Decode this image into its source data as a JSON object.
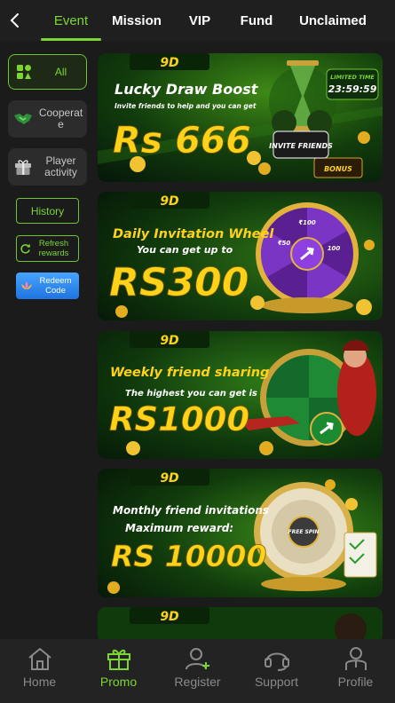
{
  "topnav": {
    "tabs": [
      {
        "label": "Event",
        "active": true
      },
      {
        "label": "Mission"
      },
      {
        "label": "VIP"
      },
      {
        "label": "Fund"
      },
      {
        "label": "Unclaimed"
      }
    ]
  },
  "sidebar": {
    "categories": [
      {
        "label": "All",
        "icon": "grid-icon",
        "active": true
      },
      {
        "label": "Cooperat e",
        "icon": "handshake-icon"
      },
      {
        "label": "Player activity",
        "icon": "gift-icon"
      }
    ],
    "history_label": "History",
    "refresh_label": "Refresh rewards",
    "redeem_label": "Redeem Code"
  },
  "banners": [
    {
      "brand": "9D",
      "title": "Lucky Draw Boost",
      "subtitle": "Invite friends to help and you can get",
      "amount": "Rs 666",
      "badge": "INVITE FRIENDS",
      "timer_label": "LIMITED TIME",
      "timer": "23:59:59",
      "corner": "BONUS"
    },
    {
      "brand": "9D",
      "title": "Daily Invitation Wheel",
      "subtitle": "You can get up to",
      "amount": "RS300",
      "wheel_labels": [
        "₹100",
        "₹50",
        "100"
      ]
    },
    {
      "brand": "9D",
      "title": "Weekly friend sharing",
      "subtitle": "The highest you can get is",
      "amount": "RS1000"
    },
    {
      "brand": "9D",
      "title": "Monthly friend invitations",
      "subtitle": "Maximum reward:",
      "amount": "RS 10000",
      "wheel_center": "FREE SPIN"
    },
    {
      "brand": "9D"
    }
  ],
  "bottomnav": {
    "items": [
      {
        "label": "Home",
        "icon": "home-icon"
      },
      {
        "label": "Promo",
        "icon": "gift-icon",
        "active": true
      },
      {
        "label": "Register",
        "icon": "add-user-icon"
      },
      {
        "label": "Support",
        "icon": "headset-icon"
      },
      {
        "label": "Profile",
        "icon": "profile-icon"
      }
    ]
  },
  "colors": {
    "accent": "#7bd633",
    "background": "#1b1b1b",
    "banner_green": "#0f3b0f",
    "gold": "#ffd21a"
  }
}
